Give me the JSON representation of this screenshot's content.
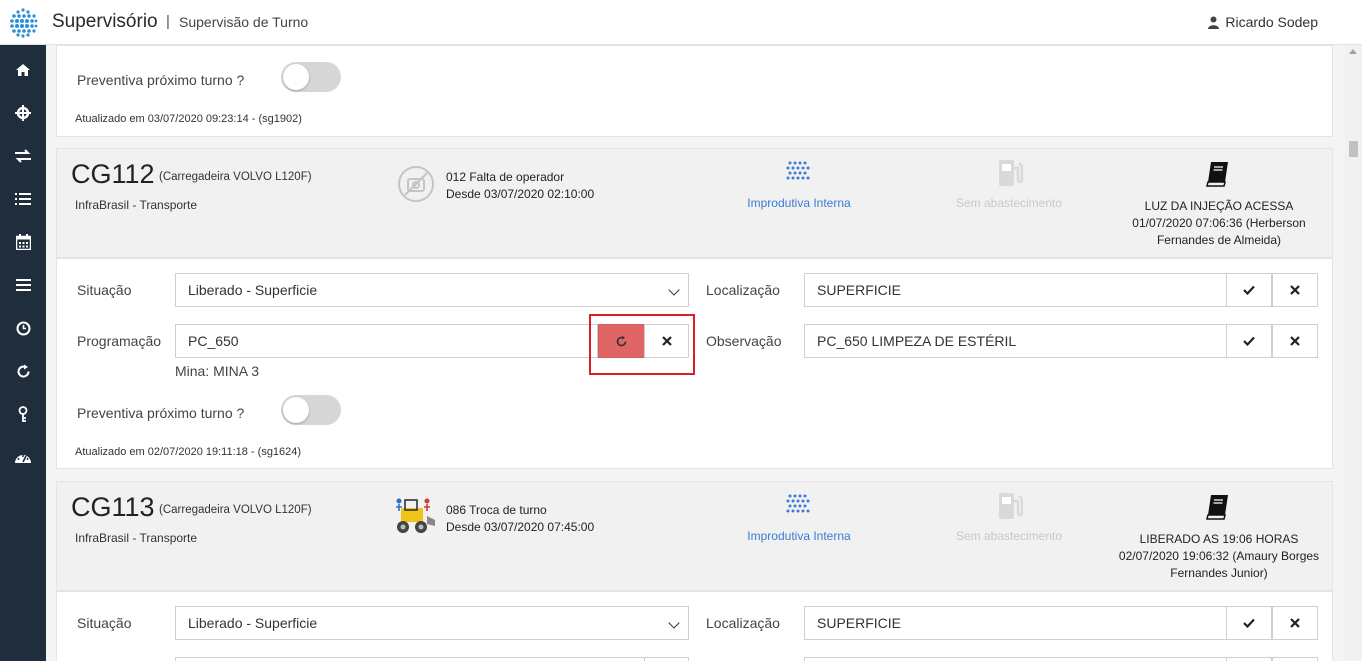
{
  "header": {
    "title": "Supervisório",
    "separator": "|",
    "subtitle": "Supervisão de Turno",
    "user": "Ricardo Sodep"
  },
  "sidebar": {
    "items": [
      "home-icon",
      "crosshair-icon",
      "exchange-icon",
      "list-icon",
      "calendar-icon",
      "menu-icon",
      "clock-icon",
      "refresh-icon",
      "key-icon",
      "dashboard-icon"
    ]
  },
  "top_section": {
    "preventiva_label": "Preventiva próximo turno ?",
    "updated": "Atualizado em 03/07/2020 09:23:14 - (sg1902)"
  },
  "cards": [
    {
      "code": "CG112",
      "model": "(Carregadeira VOLVO L120F)",
      "company": "InfraBrasil - Transporte",
      "status_code": "012 Falta de operador",
      "status_since": "Desde 03/07/2020 02:10:00",
      "improdutiva": "Improdutiva Interna",
      "abastecimento": "Sem abastecimento",
      "note_title": "LUZ DA INJEÇÃO ACESSA",
      "note_detail": "01/07/2020 07:06:36 (Herberson Fernandes de Almeida)",
      "situacao_label": "Situação",
      "situacao_value": "Liberado - Superficie",
      "localizacao_label": "Localização",
      "localizacao_value": "SUPERFICIE",
      "programacao_label": "Programação",
      "programacao_value": "PC_650",
      "mina": "Mina: MINA 3",
      "observacao_label": "Observação",
      "observacao_value": "PC_650 LIMPEZA DE ESTÉRIL",
      "preventiva_label": "Preventiva próximo turno ?",
      "updated": "Atualizado em 02/07/2020 19:11:18 - (sg1624)"
    },
    {
      "code": "CG113",
      "model": "(Carregadeira VOLVO L120F)",
      "company": "InfraBrasil - Transporte",
      "status_code": "086 Troca de turno",
      "status_since": "Desde 03/07/2020 07:45:00",
      "improdutiva": "Improdutiva Interna",
      "abastecimento": "Sem abastecimento",
      "note_title": "LIBERADO AS 19:06 HORAS",
      "note_detail": "02/07/2020 19:06:32 (Amaury Borges Fernandes Junior)",
      "situacao_label": "Situação",
      "situacao_value": "Liberado - Superficie",
      "localizacao_label": "Localização",
      "localizacao_value": "SUPERFICIE"
    }
  ],
  "colors": {
    "sidebar": "#1f2d3d",
    "accent_red": "#e06666",
    "highlight": "#d6212a",
    "link_blue": "#3a7bd5"
  }
}
